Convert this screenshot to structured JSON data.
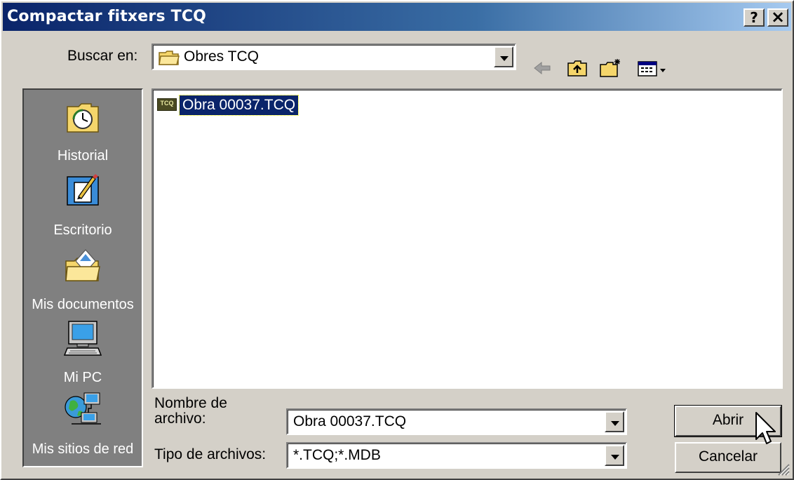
{
  "window": {
    "title": "Compactar fitxers TCQ",
    "help_button": "?",
    "close_button": "×"
  },
  "lookin": {
    "label": "Buscar en:",
    "value": "Obres TCQ"
  },
  "toolbar": {
    "icons": [
      "back-arrow-icon",
      "up-folder-icon",
      "new-folder-icon",
      "view-menu-icon"
    ]
  },
  "places": [
    {
      "label": "Historial",
      "icon": "history-icon"
    },
    {
      "label": "Escritorio",
      "icon": "desktop-icon"
    },
    {
      "label": "Mis documentos",
      "icon": "my-documents-icon"
    },
    {
      "label": "Mi PC",
      "icon": "my-computer-icon"
    },
    {
      "label": "Mis sitios de red",
      "icon": "network-places-icon"
    }
  ],
  "files": [
    {
      "name": "Obra 00037.TCQ",
      "icon_text": "TCQ",
      "selected": true
    }
  ],
  "filename": {
    "label_line1": "Nombre de",
    "label_line2": "archivo:",
    "value": "Obra 00037.TCQ"
  },
  "filetype": {
    "label": "Tipo de archivos:",
    "value": "*.TCQ;*.MDB"
  },
  "buttons": {
    "open": "Abrir",
    "cancel": "Cancelar"
  },
  "colors": {
    "title_gradient_start": "#0a246a",
    "selection": "#0a246a",
    "places_bg": "#808080",
    "face": "#d4d0c8"
  }
}
